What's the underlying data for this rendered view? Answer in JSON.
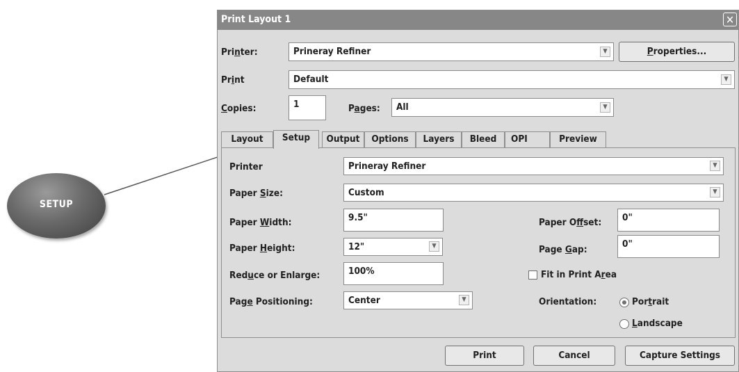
{
  "callout": {
    "label": "SETUP"
  },
  "dialog": {
    "title": "Print Layout 1",
    "close_glyph": "✕",
    "printer": {
      "label_pre": "Pri",
      "label_u": "n",
      "label_post": "ter:",
      "value": "Prineray Refiner"
    },
    "properties_button": {
      "u": "P",
      "rest": "roperties..."
    },
    "print_style": {
      "label_pre": "Pr",
      "label_u": "i",
      "label_post": "nt",
      "value": "Default"
    },
    "copies": {
      "label_u": "C",
      "label_post": "opies:",
      "value": "1"
    },
    "pages": {
      "label_pre": "P",
      "label_u": "a",
      "label_post": "ges:",
      "value": "All"
    },
    "tabs": [
      "Layout",
      "Setup",
      "Output",
      "Options",
      "Layers",
      "Bleed",
      "OPI",
      "Preview"
    ],
    "active_tab": "Setup",
    "setup": {
      "printer": {
        "label": "Printer",
        "value": "Prineray Refiner"
      },
      "paper_size": {
        "label_pre": "Paper ",
        "label_u": "S",
        "label_post": "ize:",
        "value": "Custom"
      },
      "paper_width": {
        "label_pre": "Paper ",
        "label_u": "W",
        "label_post": "idth:",
        "value": "9.5\""
      },
      "paper_height": {
        "label_pre": "Paper ",
        "label_u": "H",
        "label_post": "eight:",
        "value": "12\""
      },
      "reduce_enlarge": {
        "label_pre": "Red",
        "label_u": "u",
        "label_post": "ce or Enlarge:",
        "value": "100%"
      },
      "page_positioning": {
        "label_pre": "Pag",
        "label_u": "e",
        "label_post": " Positioning:",
        "value": "Center"
      },
      "paper_offset": {
        "label_pre": "Paper O",
        "label_u": "f",
        "label_post": "fset:",
        "value": "0\""
      },
      "page_gap": {
        "label_pre": "Page ",
        "label_u": "G",
        "label_post": "ap:",
        "value": "0\""
      },
      "fit_in_print_area": {
        "label_pre": "Fit in Print A",
        "label_u": "r",
        "label_post": "ea",
        "checked": false
      },
      "orientation": {
        "label": "Orientation:",
        "portrait": {
          "pre": "Por",
          "u": "t",
          "post": "rait",
          "selected": true
        },
        "landscape": {
          "u": "L",
          "post": "andscape",
          "selected": false
        }
      }
    },
    "buttons": {
      "print": "Print",
      "cancel": "Cancel",
      "capture": "Capture Settings"
    },
    "colors": {
      "titlebar": "#878787",
      "dialog_bg": "#dcdcdc",
      "callout": "#5a5a5a"
    }
  }
}
